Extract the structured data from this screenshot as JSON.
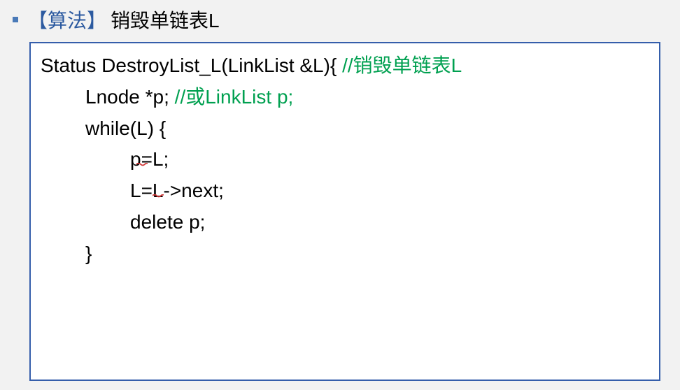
{
  "heading": {
    "bracket_label": "【算法】",
    "title_text": "销毁单链表L"
  },
  "code": {
    "line1_a": "Status DestroyList_L(LinkList &L){  ",
    "line1_comment": "//销毁单链表L",
    "line2_a": "Lnode *p;  ",
    "line2_comment": "//或LinkList p;",
    "line3_a": "while(",
    "line3_squiggle": "L",
    "line3_b": ") {",
    "line4_a": "p=",
    "line4_squiggle": "L",
    "line4_b": ";",
    "line5": "L=L->next;",
    "line6": "delete p;",
    "line7": "}"
  },
  "colors": {
    "bracket": "#2c5aa0",
    "border": "#355eab",
    "comment": "#00a050",
    "squiggle": "#d23636"
  }
}
